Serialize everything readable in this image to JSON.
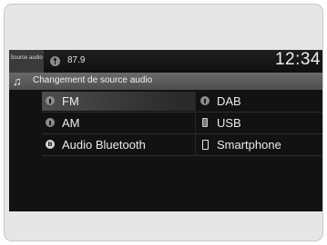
{
  "status_bar": {
    "source_tab": "Source audio",
    "frequency": "87.9",
    "clock": "12:34"
  },
  "title_bar": {
    "title": "Changement de source audio"
  },
  "sources": [
    {
      "label": "FM",
      "icon": "antenna-icon",
      "selected": true
    },
    {
      "label": "DAB",
      "icon": "antenna-icon",
      "selected": false
    },
    {
      "label": "AM",
      "icon": "antenna-icon",
      "selected": false
    },
    {
      "label": "USB",
      "icon": "usb-icon",
      "selected": false
    },
    {
      "label": "Audio Bluetooth",
      "icon": "bluetooth-icon",
      "selected": false
    },
    {
      "label": "Smartphone",
      "icon": "smartphone-icon",
      "selected": false
    }
  ]
}
